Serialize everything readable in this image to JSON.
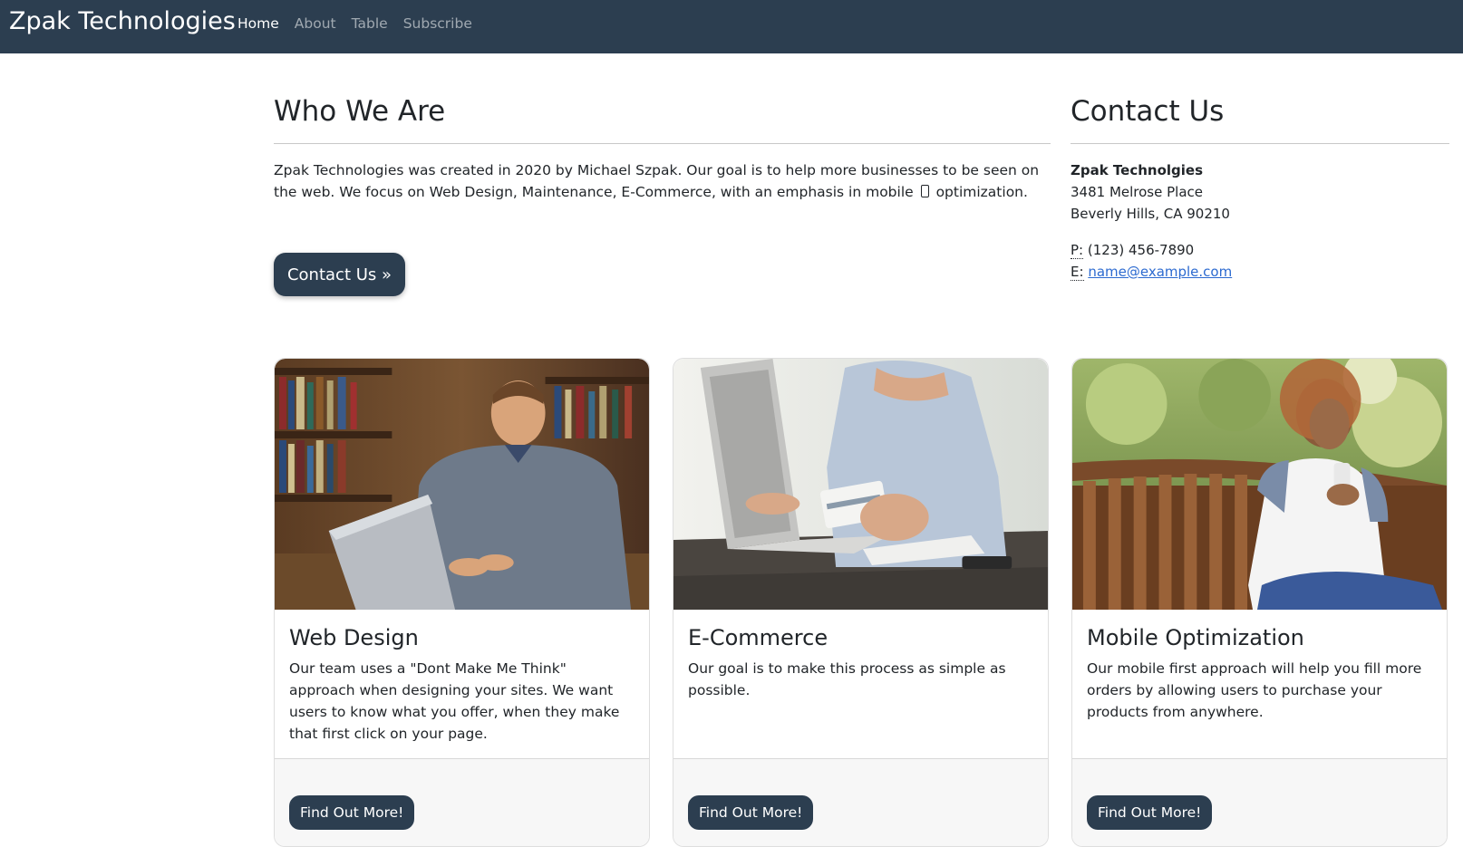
{
  "navbar": {
    "brand": "Zpak Technologies",
    "links": [
      "Home",
      "About",
      "Table",
      "Subscribe"
    ],
    "active": "Home",
    "background": "#2c3e50"
  },
  "about": {
    "heading": "Who We Are",
    "text_before_icon": "Zpak Technologies was created in 2020 by Michael Szpak. Our goal is to help more businesses to be seen on the web. We focus on Web Design, Maintenance, E-Commerce, with an emphasis in mobile",
    "icon": "mobile-phone-icon",
    "text_after_icon": "optimization.",
    "button": "Contact Us »"
  },
  "contact": {
    "heading": "Contact Us",
    "company": "Zpak Technolgies",
    "street": "3481 Melrose Place",
    "city": "Beverly Hills, CA 90210",
    "phone_label": "P:",
    "phone": "(123) 456-7890",
    "email_label": "E:",
    "email": "name@example.com"
  },
  "cards": [
    {
      "title": "Web Design",
      "text": "Our team uses a \"Dont Make Me Think\" approach when designing your sites. We want users to know what you offer, when they make that first click on your page.",
      "button": "Find Out More!",
      "image": "man-on-laptop-in-library-photo"
    },
    {
      "title": "E-Commerce",
      "text": "Our goal is to make this process as simple as possible.",
      "button": "Find Out More!",
      "image": "hand-holding-credit-card-laptop-photo"
    },
    {
      "title": "Mobile Optimization",
      "text": "Our mobile first approach will help you fill more orders by allowing users to purchase your products from anywhere.",
      "button": "Find Out More!",
      "image": "woman-on-bench-with-phone-photo"
    }
  ],
  "colors": {
    "primary": "#2c3e50",
    "link": "#2c6ad0",
    "footer": "#f7f7f7"
  }
}
